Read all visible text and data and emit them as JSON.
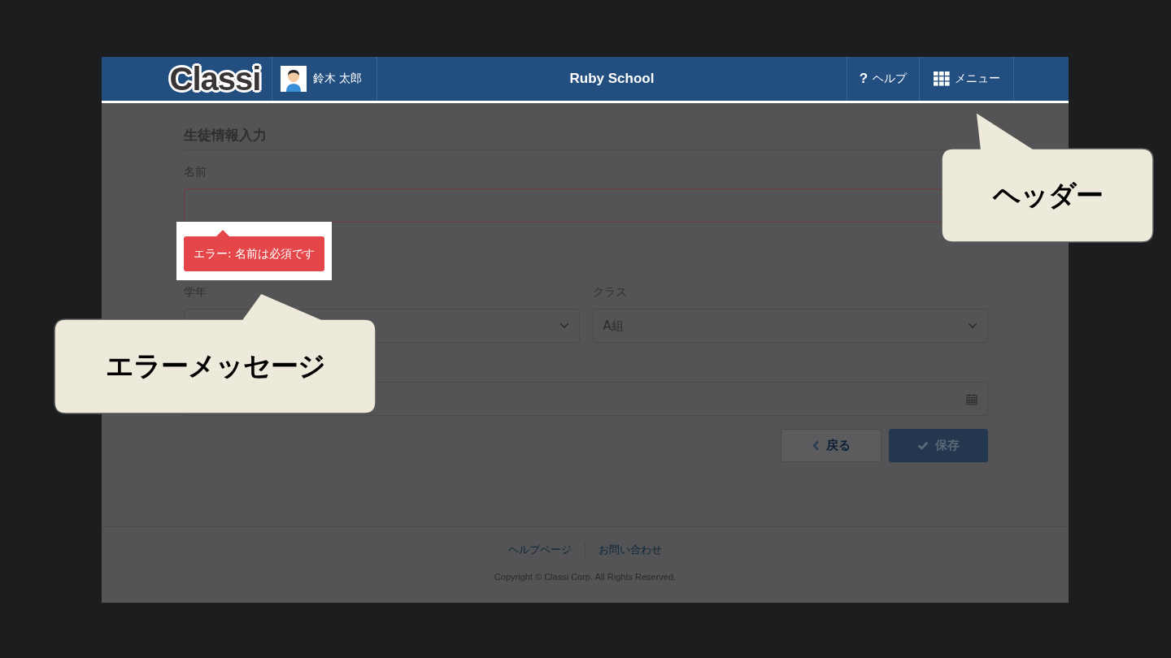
{
  "header": {
    "logo": "Classi",
    "user": {
      "name": "鈴木 太郎"
    },
    "title": "Ruby School",
    "nav": [
      {
        "kind": "help",
        "icon": "?",
        "label": "ヘルプ"
      },
      {
        "kind": "menu",
        "label": "メニュー"
      }
    ]
  },
  "form": {
    "title": "生徒情報入力",
    "fields": [
      {
        "kind": "text",
        "label": "名前",
        "error": "エラー: 名前は必須です"
      },
      {
        "kind": "select",
        "label": "学年"
      },
      {
        "kind": "select",
        "label": "クラス",
        "value": "A組"
      },
      {
        "kind": "date"
      }
    ],
    "buttons": [
      {
        "kind": "back",
        "label": "戻る"
      },
      {
        "kind": "primary",
        "label": "保存"
      }
    ]
  },
  "footer": {
    "links": [
      "ヘルプページ",
      "お問い合わせ"
    ],
    "copyright": "Copyright © Classi Corp. All Rights Reserved."
  },
  "callouts": [
    {
      "kind": "header",
      "text": "ヘッダー"
    },
    {
      "kind": "error",
      "text": "エラーメッセージ"
    }
  ]
}
